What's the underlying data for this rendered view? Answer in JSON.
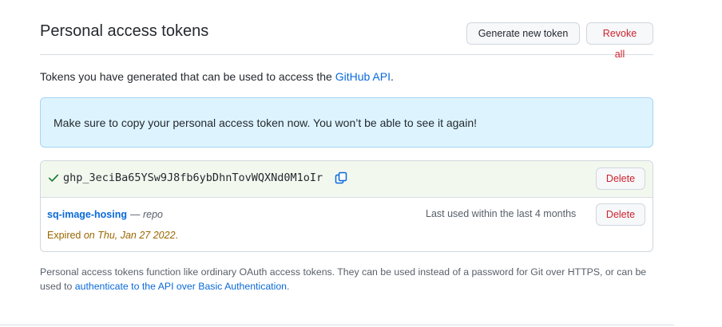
{
  "header": {
    "title": "Personal access tokens",
    "generate_label": "Generate new token",
    "revoke_label": "Revoke all"
  },
  "intro": {
    "text": "Tokens you have generated that can be used to access the ",
    "link": "GitHub API",
    "suffix": "."
  },
  "flash": {
    "message": "Make sure to copy your personal access token now. You won’t be able to see it again!"
  },
  "tokens": {
    "new_token": {
      "value": "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",
      "delete_label": "Delete"
    },
    "existing": [
      {
        "name": "sq-image-hosing",
        "scope": "— repo",
        "last_used": "Last used within the last 4 months",
        "expired_prefix": "Expired ",
        "expired_date": "on Thu, Jan 27 2022",
        "expired_suffix": ".",
        "delete_label": "Delete"
      }
    ]
  },
  "note": {
    "text": "Personal access tokens function like ordinary OAuth access tokens. They can be used instead of a password for Git over HTTPS, or can be used to ",
    "link": "authenticate to the API over Basic Authentication",
    "suffix": "."
  },
  "colors": {
    "accent": "#0969da",
    "danger": "#cf222e",
    "success": "#1a7f37",
    "attention": "#9a6700",
    "flash_bg": "#ddf4ff"
  },
  "icons": {
    "check": "check-icon",
    "copy": "copy-icon"
  }
}
